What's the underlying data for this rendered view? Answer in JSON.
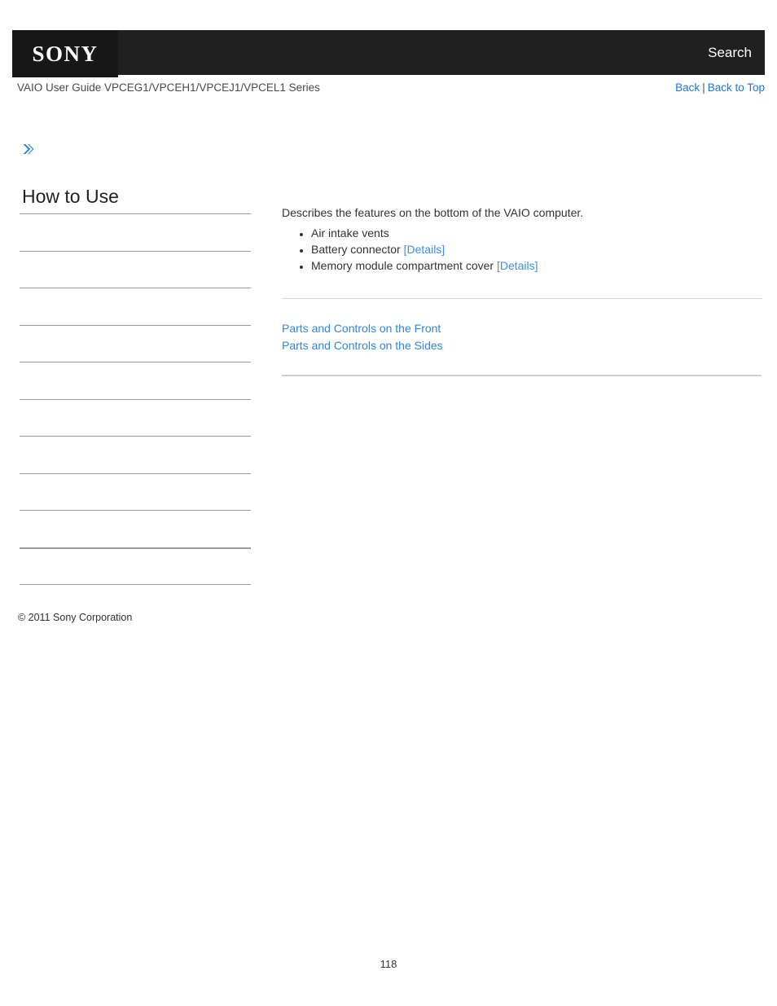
{
  "header": {
    "logo_text": "SONY",
    "logo_name": "sony-logo",
    "search_label": "Search",
    "background": "#202020",
    "logo_background": "#171717"
  },
  "guide_bar": {
    "title": "VAIO User Guide VPCEG1/VPCEH1/VPCEJ1/VPCEL1 Series",
    "back_label": "Back",
    "separator": "|",
    "back_to_top_label": "Back to Top",
    "link_color": "#1878d4"
  },
  "marker": {
    "icon": "double-chevron-right-icon",
    "color": "#2a86c8"
  },
  "sidebar": {
    "heading": "How to Use",
    "items": [
      {
        "label": ""
      },
      {
        "label": ""
      },
      {
        "label": ""
      },
      {
        "label": ""
      },
      {
        "label": ""
      },
      {
        "label": ""
      },
      {
        "label": ""
      },
      {
        "label": ""
      },
      {
        "label": ""
      },
      {
        "label": ""
      }
    ],
    "copyright": "© 2011 Sony Corporation"
  },
  "content": {
    "intro": "Describes the features on the bottom of the VAIO computer.",
    "features": [
      {
        "text": "Air intake vents",
        "link": ""
      },
      {
        "text": "Battery connector",
        "link": "[Details]"
      },
      {
        "text": "Memory module compartment cover",
        "link": "[Details]"
      }
    ],
    "related_links": [
      "Parts and Controls on the Front",
      "Parts and Controls on the Sides"
    ],
    "link_color": "#3e8ede"
  },
  "footer": {
    "page_number": "118"
  }
}
